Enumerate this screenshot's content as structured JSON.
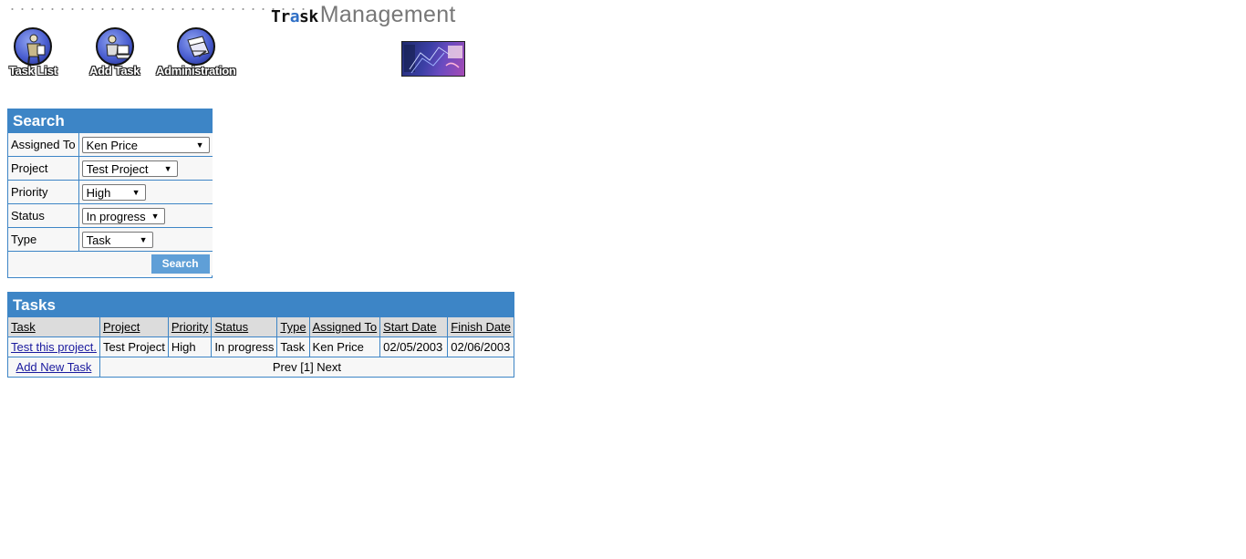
{
  "header": {
    "logo_part1_a": "Tr",
    "logo_part1_b": "a",
    "logo_part1_c": "sk",
    "logo_part2": "Management"
  },
  "nav": [
    {
      "label": "Task List",
      "icon": "person-document-icon"
    },
    {
      "label": "Add Task",
      "icon": "person-computer-icon"
    },
    {
      "label": "Administration",
      "icon": "admin-papers-icon"
    }
  ],
  "search": {
    "title": "Search",
    "fields": [
      {
        "label": "Assigned To",
        "value": "Ken Price"
      },
      {
        "label": "Project",
        "value": "Test Project"
      },
      {
        "label": "Priority",
        "value": "High"
      },
      {
        "label": "Status",
        "value": "In progress"
      },
      {
        "label": "Type",
        "value": "Task"
      }
    ],
    "button": "Search"
  },
  "tasks": {
    "title": "Tasks",
    "columns": [
      "Task",
      "Project",
      "Priority",
      "Status",
      "Type",
      "Assigned To",
      "Start Date",
      "Finish Date"
    ],
    "rows": [
      [
        "Test this project.",
        "Test Project",
        "High",
        "In progress",
        "Task",
        "Ken Price",
        "02/05/2003",
        "02/06/2003"
      ]
    ],
    "add_new": "Add New Task",
    "pager": "Prev [1] Next"
  },
  "colors": {
    "panel_blue": "#3d85c6",
    "button_blue": "#5f9fd7",
    "header_gray": "#dcdcdc",
    "cell_bg": "#f7f7f7"
  }
}
